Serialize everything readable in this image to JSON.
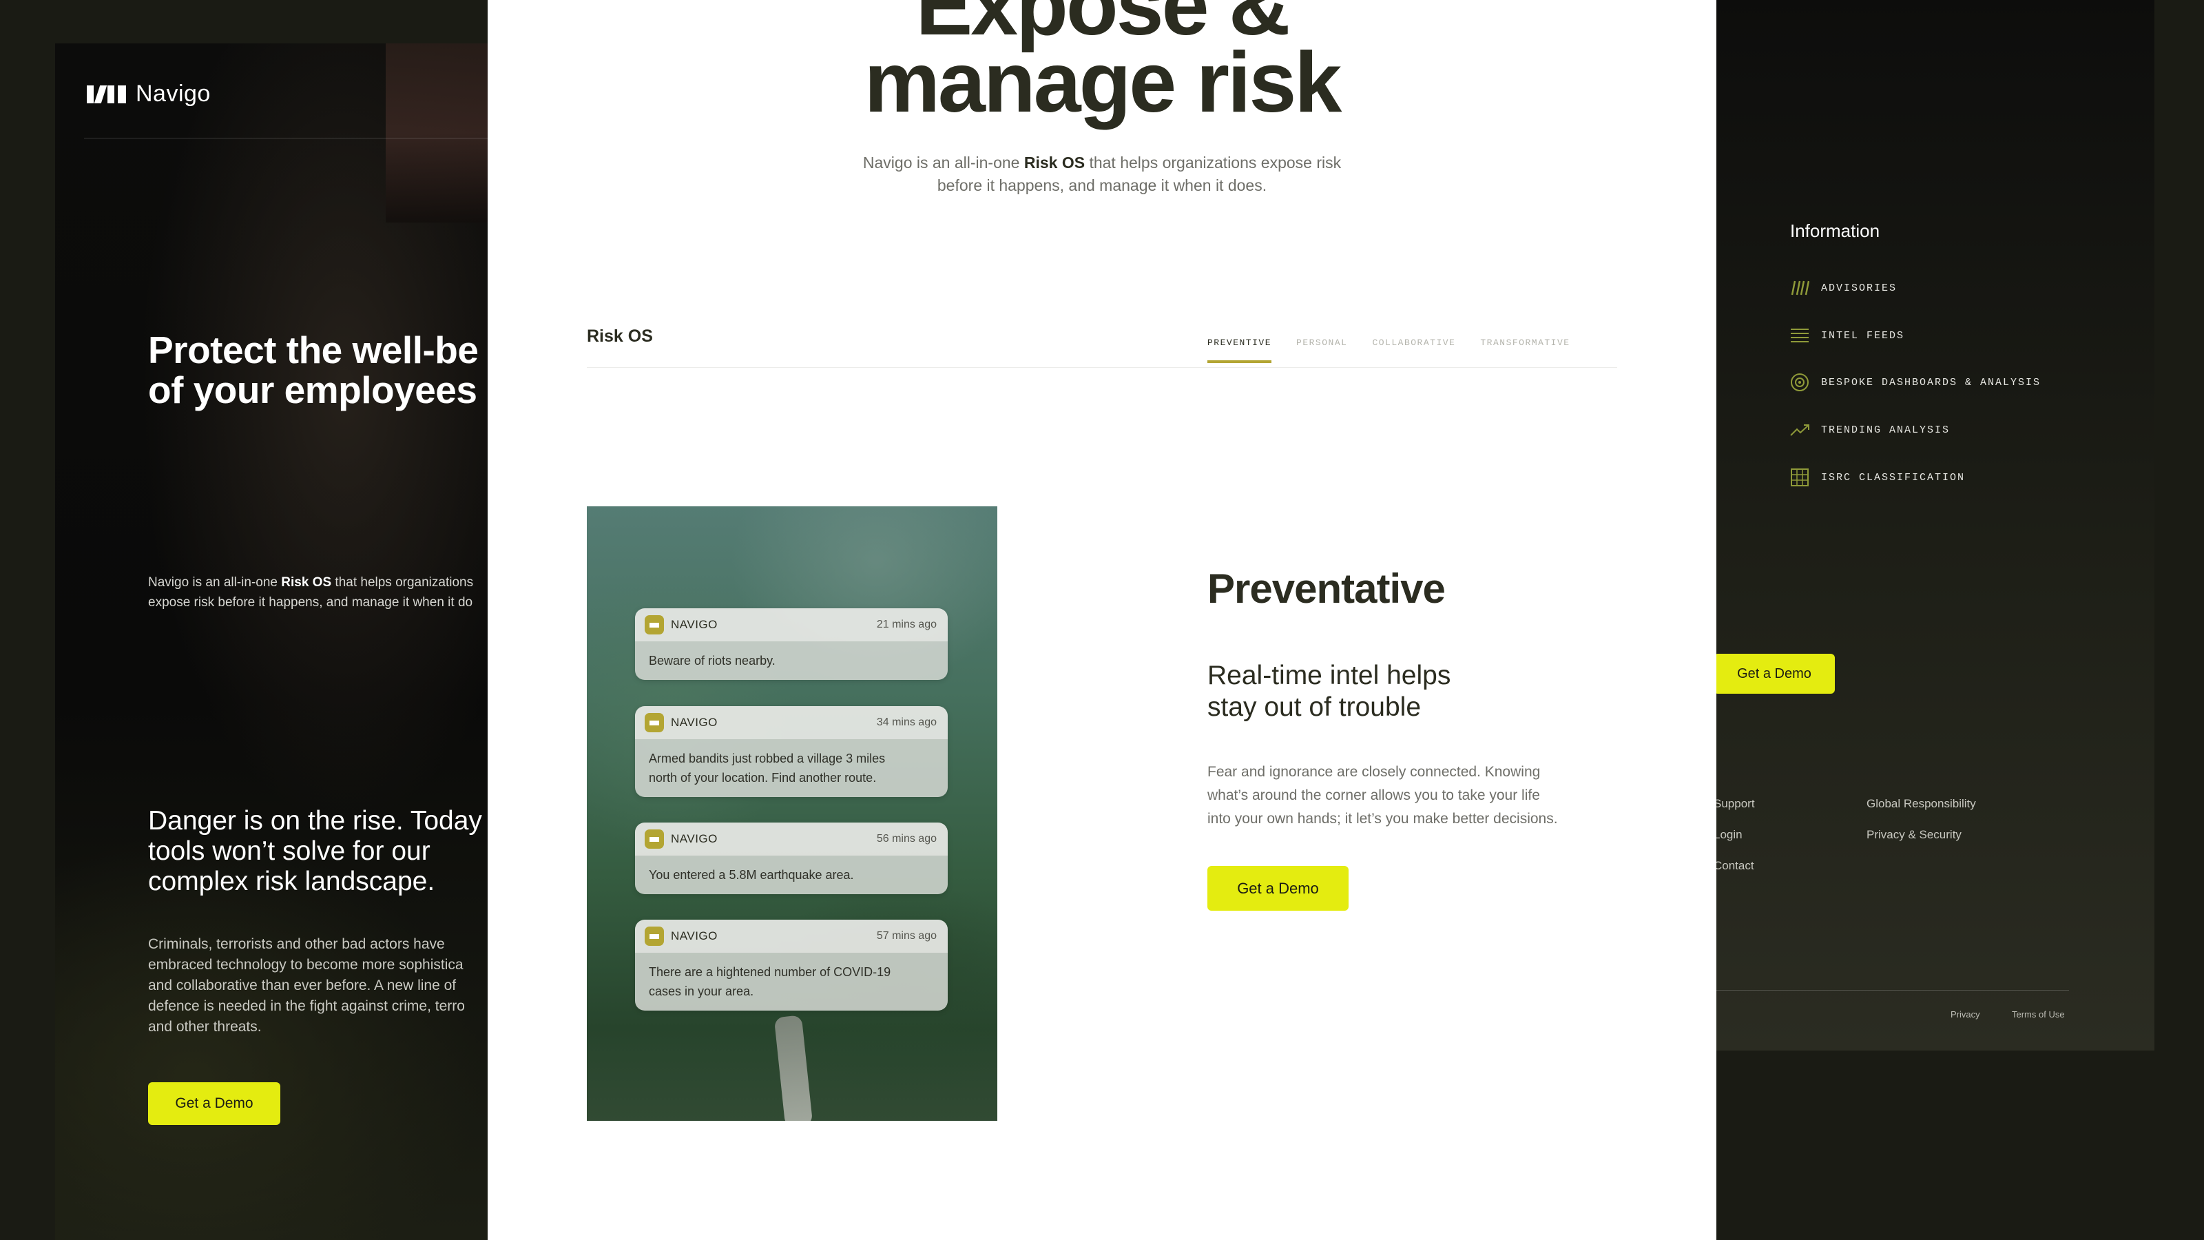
{
  "left": {
    "logo_text": "Navigo",
    "hero_title_line1": "Protect the well-be",
    "hero_title_line2": "of your employees",
    "hero_body_prefix": "Navigo is an all-in-one ",
    "hero_body_bold": "Risk OS",
    "hero_body_suffix": " that helps organizations",
    "hero_body_line2": "expose risk before it happens, and manage it when it do",
    "danger_line1": "Danger is on the rise. Today",
    "danger_line2": "tools won’t solve for our",
    "danger_line3": "complex risk landscape.",
    "body_line1": "Criminals, terrorists and other bad actors have",
    "body_line2": "embraced technology to become more sophistica",
    "body_line3": "and collaborative than ever before. A new line of",
    "body_line4": "defence is needed in the fight against crime, terro",
    "body_line5": "and other threats.",
    "demo_label": "Get a Demo"
  },
  "center": {
    "hero_title_line1": "Expose &",
    "hero_title_line2": "manage risk",
    "sub_prefix": "Navigo is an all-in-one ",
    "sub_bold": "Risk OS",
    "sub_suffix": " that helps organizations expose risk",
    "sub_line2": "before it happens, and manage it when it does.",
    "section_label": "Risk OS",
    "tabs": [
      "PREVENTIVE",
      "PERSONAL",
      "COLLABORATIVE",
      "TRANSFORMATIVE"
    ],
    "notifications": [
      {
        "app": "NAVIGO",
        "time": "21 mins ago",
        "line1": "Beware of riots nearby.",
        "line2": ""
      },
      {
        "app": "NAVIGO",
        "time": "34 mins ago",
        "line1": "Armed bandits just robbed a village 3 miles",
        "line2": "north of your location. Find another route."
      },
      {
        "app": "NAVIGO",
        "time": "56 mins ago",
        "line1": "You entered a 5.8M earthquake area.",
        "line2": ""
      },
      {
        "app": "NAVIGO",
        "time": "57 mins ago",
        "line1": "There are a hightened number of COVID-19",
        "line2": "cases in your area."
      }
    ],
    "feature_title": "Preventative",
    "feature_subtitle_line1": "Real-time intel helps",
    "feature_subtitle_line2": "stay out of trouble",
    "feature_body_line1": "Fear and ignorance are closely connected. Knowing",
    "feature_body_line2": "what’s around the corner allows you to take your life",
    "feature_body_line3": "into your own hands; it let’s you make better decisions.",
    "demo_label": "Get a Demo"
  },
  "right": {
    "info_title": "Information",
    "info_items": [
      {
        "label": "ADVISORIES",
        "icon": "quote-icon"
      },
      {
        "label": "INTEL FEEDS",
        "icon": "lines-icon"
      },
      {
        "label": "BESPOKE DASHBOARDS & ANALYSIS",
        "icon": "target-icon"
      },
      {
        "label": "TRENDING ANALYSIS",
        "icon": "trend-icon"
      },
      {
        "label": "ISRC CLASSIFICATION",
        "icon": "grid-icon"
      }
    ],
    "demo_label": "Get a Demo",
    "footer_col1": [
      "Support",
      "Login",
      "Contact"
    ],
    "footer_col2": [
      "Global Responsibility",
      "Privacy & Security"
    ],
    "legal_privacy": "Privacy",
    "legal_terms": "Terms of Use"
  },
  "colors": {
    "accent": "#e4ec10",
    "tab_underline": "#b3a533",
    "ink": "#2b2c20",
    "icon_green": "#8f9a39"
  }
}
